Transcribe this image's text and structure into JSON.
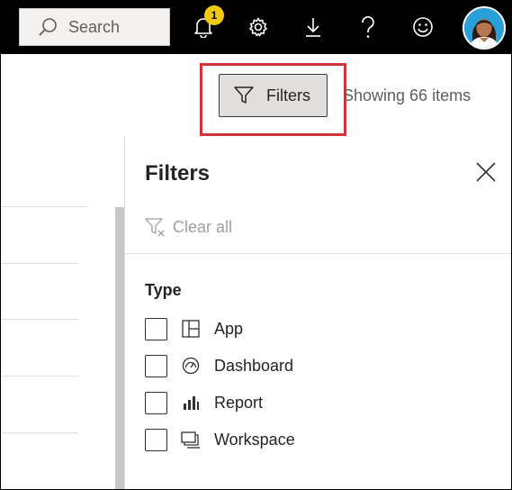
{
  "topbar": {
    "search_placeholder": "Search",
    "notification_count": "1",
    "icons": [
      "bell-icon",
      "gear-icon",
      "download-icon",
      "help-icon",
      "smiley-icon"
    ]
  },
  "toolbar": {
    "filters_label": "Filters",
    "showing_text": "Showing 66 items"
  },
  "filters_pane": {
    "title": "Filters",
    "clear_all_label": "Clear all",
    "type_heading": "Type",
    "options": [
      {
        "label": "App",
        "icon": "app-icon",
        "checked": false
      },
      {
        "label": "Dashboard",
        "icon": "dashboard-icon",
        "checked": false
      },
      {
        "label": "Report",
        "icon": "report-icon",
        "checked": false
      },
      {
        "label": "Workspace",
        "icon": "workspace-icon",
        "checked": false
      }
    ]
  },
  "colors": {
    "topbar_bg": "#000000",
    "badge": "#f2c811",
    "highlight": "#d13438",
    "avatar_bg": "#2aa0d8"
  }
}
